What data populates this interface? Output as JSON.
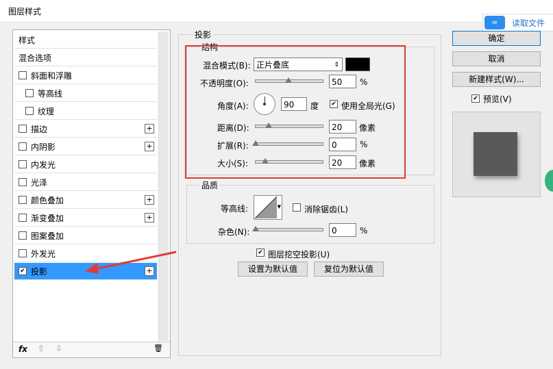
{
  "window": {
    "title": "图层样式"
  },
  "badge": {
    "logo": "∞",
    "text": "读取文件"
  },
  "left_panel": {
    "items": [
      {
        "label": "样式",
        "checkbox": false,
        "plus": false,
        "indent": 0,
        "selected": false
      },
      {
        "label": "混合选项",
        "checkbox": false,
        "plus": false,
        "indent": 0,
        "selected": false
      },
      {
        "label": "斜面和浮雕",
        "checkbox": true,
        "checked": false,
        "plus": false,
        "indent": 0,
        "selected": false
      },
      {
        "label": "等高线",
        "checkbox": true,
        "checked": false,
        "plus": false,
        "indent": 1,
        "selected": false
      },
      {
        "label": "纹理",
        "checkbox": true,
        "checked": false,
        "plus": false,
        "indent": 1,
        "selected": false
      },
      {
        "label": "描边",
        "checkbox": true,
        "checked": false,
        "plus": true,
        "indent": 0,
        "selected": false
      },
      {
        "label": "内阴影",
        "checkbox": true,
        "checked": false,
        "plus": true,
        "indent": 0,
        "selected": false
      },
      {
        "label": "内发光",
        "checkbox": true,
        "checked": false,
        "plus": false,
        "indent": 0,
        "selected": false
      },
      {
        "label": "光泽",
        "checkbox": true,
        "checked": false,
        "plus": false,
        "indent": 0,
        "selected": false
      },
      {
        "label": "颜色叠加",
        "checkbox": true,
        "checked": false,
        "plus": true,
        "indent": 0,
        "selected": false
      },
      {
        "label": "渐变叠加",
        "checkbox": true,
        "checked": false,
        "plus": true,
        "indent": 0,
        "selected": false
      },
      {
        "label": "图案叠加",
        "checkbox": true,
        "checked": false,
        "plus": false,
        "indent": 0,
        "selected": false
      },
      {
        "label": "外发光",
        "checkbox": true,
        "checked": false,
        "plus": false,
        "indent": 0,
        "selected": false
      },
      {
        "label": "投影",
        "checkbox": true,
        "checked": true,
        "plus": true,
        "indent": 0,
        "selected": true
      }
    ],
    "footer": {
      "fx": "fx",
      "up": "⇧",
      "down": "⇩",
      "trash": "🗑"
    }
  },
  "shadow": {
    "section_title": "投影",
    "structure_title": "结构",
    "blend_mode_label": "混合模式(B):",
    "blend_mode_value": "正片叠底",
    "blend_color": "#000000",
    "opacity_label": "不透明度(O):",
    "opacity_value": "50",
    "opacity_fraction": 0.5,
    "pct": "%",
    "angle_label": "角度(A):",
    "angle_value": "90",
    "angle_unit": "度",
    "global_light_label": "使用全局光(G)",
    "distance_label": "距离(D):",
    "distance_value": "20",
    "pixel_unit": "像素",
    "spread_label": "扩展(R):",
    "spread_value": "0",
    "size_label": "大小(S):",
    "size_value": "20",
    "quality_title": "品质",
    "contour_label": "等高线:",
    "antialias_label": "消除锯齿(L)",
    "noise_label": "杂色(N):",
    "noise_value": "0",
    "knockout_label": "图层挖空投影(U)",
    "set_default_label": "设置为默认值",
    "reset_default_label": "复位为默认值"
  },
  "right": {
    "ok_label": "确定",
    "cancel_label": "取消",
    "new_style_label": "新建样式(W)...",
    "preview_label": "预览(V)",
    "swatch_color": "#595959"
  },
  "annotation_color": "#e53935"
}
